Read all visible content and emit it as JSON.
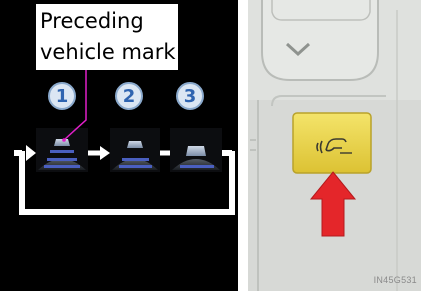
{
  "callout": {
    "line1": "Preceding",
    "line2": "vehicle mark"
  },
  "steps": [
    {
      "number": "1"
    },
    {
      "number": "2"
    },
    {
      "number": "3"
    }
  ],
  "watermark_code": "IN45G531",
  "colors": {
    "callout_line": "#e01fc8",
    "badge_text": "#2f64b0",
    "button_yellow": "#ecd64a",
    "pointer_arrow": "#e4262a",
    "panel_gray": "#d7d9d6",
    "distance_bar": "#4a5fc0"
  },
  "icons": {
    "distance_button_symbol": "distance-control-icon",
    "chevron": "chevron-down-icon"
  }
}
